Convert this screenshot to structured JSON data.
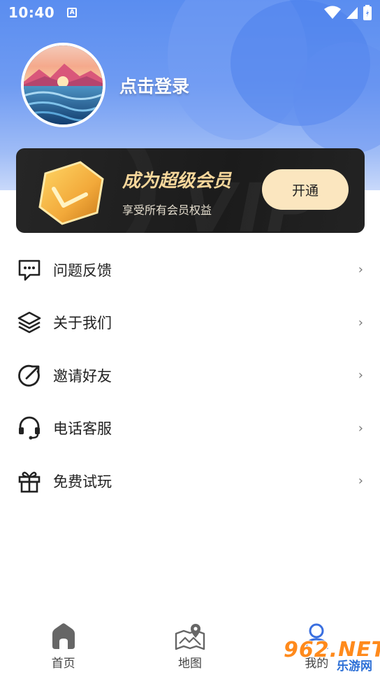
{
  "status_bar": {
    "time": "10:40",
    "notification_letter": "A"
  },
  "profile": {
    "login_text": "点击登录"
  },
  "vip": {
    "title": "成为超级会员",
    "subtitle": "享受所有会员权益",
    "button_label": "开通",
    "watermark": "VIP"
  },
  "menu": {
    "items": [
      {
        "label": "问题反馈",
        "icon": "feedback-icon"
      },
      {
        "label": "关于我们",
        "icon": "layers-icon"
      },
      {
        "label": "邀请好友",
        "icon": "invite-icon"
      },
      {
        "label": "电话客服",
        "icon": "headset-icon"
      },
      {
        "label": "免费试玩",
        "icon": "gift-icon"
      }
    ],
    "chevron": "›"
  },
  "bottom_nav": {
    "items": [
      {
        "label": "首页",
        "icon": "home-icon"
      },
      {
        "label": "地图",
        "icon": "map-icon"
      },
      {
        "label": "我的",
        "icon": "profile-icon"
      }
    ]
  },
  "watermark": {
    "brand": "962.NET",
    "brand_sub": "乐游网"
  }
}
